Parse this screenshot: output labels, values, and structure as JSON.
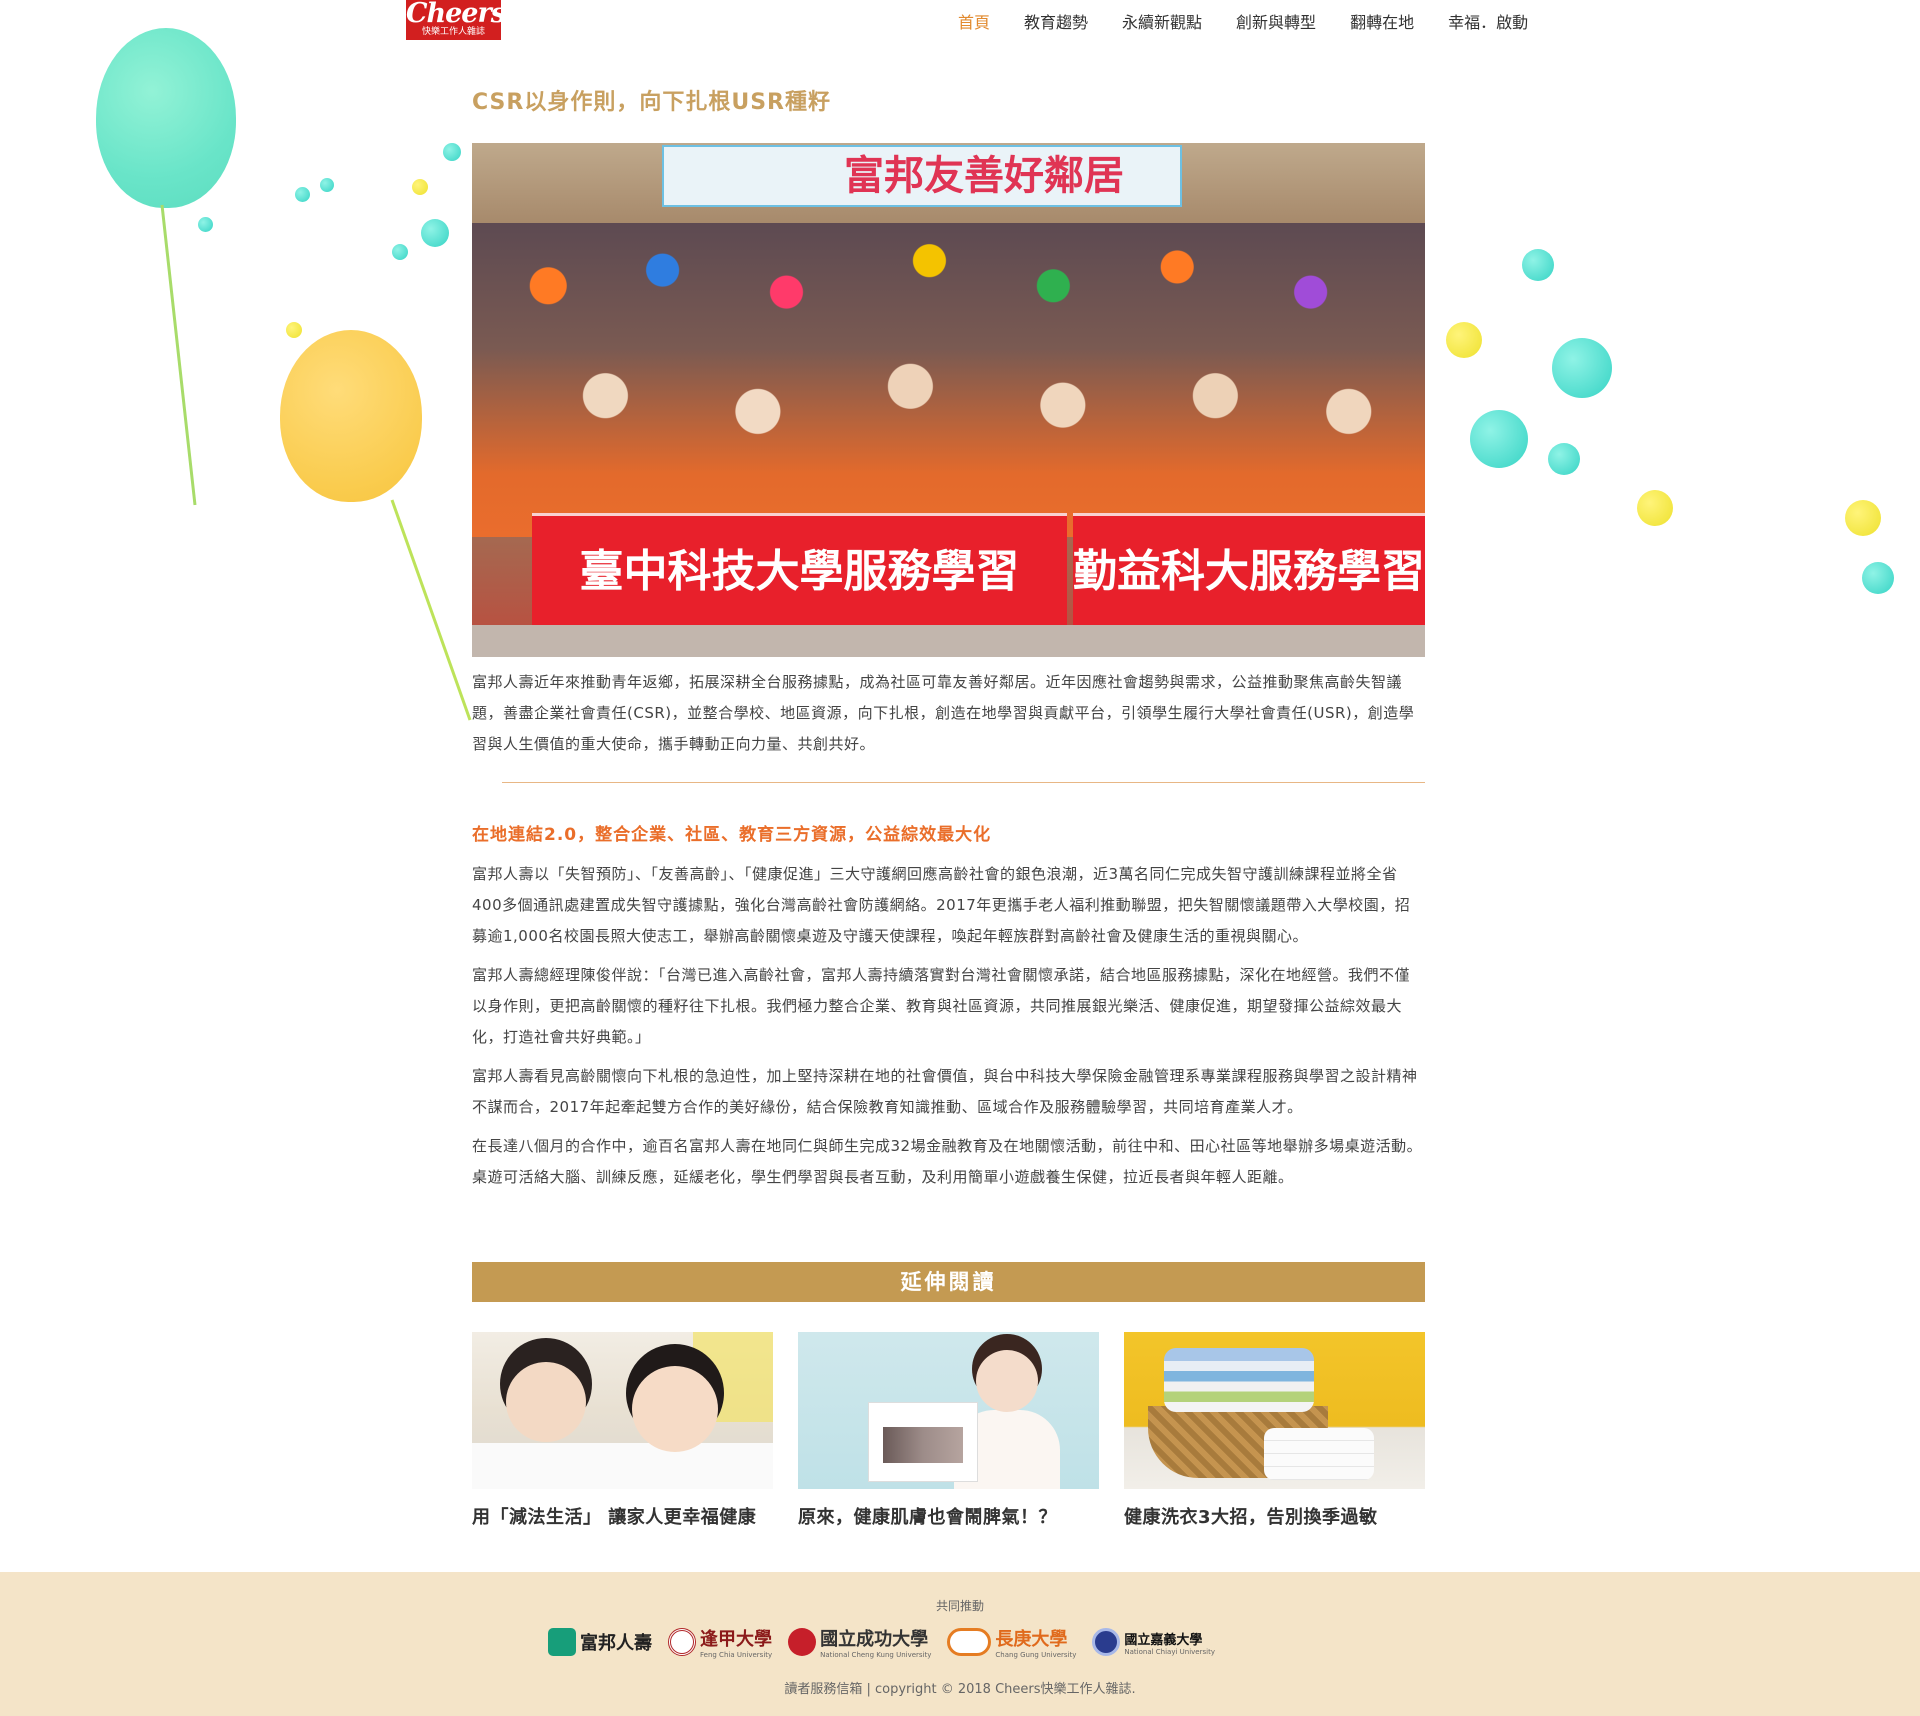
{
  "header": {
    "logo_text": "Cheers",
    "logo_sub": "快樂工作人雜誌",
    "nav": [
      {
        "label": "首頁",
        "active": true
      },
      {
        "label": "教育趨勢"
      },
      {
        "label": "永續新觀點"
      },
      {
        "label": "創新與轉型"
      },
      {
        "label": "翻轉在地"
      },
      {
        "label": "幸福．啟動"
      }
    ]
  },
  "article": {
    "title": "CSR以身作則，向下扎根USR種籽",
    "photo": {
      "banner_top": "富邦友善好鄰居",
      "banner_bottom_left": "臺中科技大學服務學習",
      "banner_bottom_right": "勤益科大服務學習"
    },
    "lead": "富邦人壽近年來推動青年返鄉，拓展深耕全台服務據點，成為社區可靠友善好鄰居。近年因應社會趨勢與需求，公益推動聚焦高齡失智議題，善盡企業社會責任(CSR)，並整合學校、地區資源，向下扎根，創造在地學習與貢獻平台，引領學生履行大學社會責任(USR)，創造學習與人生價值的重大使命，攜手轉動正向力量、共創共好。",
    "subheading": "在地連結2.0，整合企業、社區、教育三方資源，公益綜效最大化",
    "paragraphs": [
      "富邦人壽以「失智預防」、「友善高齡」、「健康促進」三大守護網回應高齡社會的銀色浪潮，近3萬名同仁完成失智守護訓練課程並將全省400多個通訊處建置成失智守護據點，強化台灣高齡社會防護網絡。2017年更攜手老人福利推動聯盟，把失智關懷議題帶入大學校園，招募逾1,000名校園長照大使志工，舉辦高齡關懷桌遊及守護天使課程，喚起年輕族群對高齡社會及健康生活的重視與關心。",
      "富邦人壽總經理陳俊伴說：「台灣已進入高齡社會，富邦人壽持續落實對台灣社會關懷承諾，結合地區服務據點，深化在地經營。我們不僅以身作則，更把高齡關懷的種籽往下扎根。我們極力整合企業、教育與社區資源，共同推展銀光樂活、健康促進，期望發揮公益綜效最大化，打造社會共好典範。」",
      "富邦人壽看見高齡關懷向下札根的急迫性，加上堅持深耕在地的社會價值，與台中科技大學保險金融管理系專業課程服務與學習之設計精神不謀而合，2017年起牽起雙方合作的美好緣份，結合保險教育知識推動、區域合作及服務體驗學習，共同培育產業人才。",
      "在長達八個月的合作中，逾百名富邦人壽在地同仁與師生完成32場金融教育及在地關懷活動，前往中和、田心社區等地舉辦多場桌遊活動。桌遊可活絡大腦、訓練反應，延緩老化，學生們學習與長者互動，及利用簡單小遊戲養生保健，拉近長者與年輕人距離。"
    ]
  },
  "extended": {
    "heading": "延伸閱讀",
    "cards": [
      {
        "caption": "用「減法生活」 讓家人更幸福健康"
      },
      {
        "caption": "原來，健康肌膚也會鬧脾氣！？"
      },
      {
        "caption": "健康洗衣3大招，告別換季過敏"
      }
    ]
  },
  "footer": {
    "co_label": "共同推動",
    "partners": [
      {
        "name": "富邦人壽",
        "en": ""
      },
      {
        "name": "逢甲大學",
        "en": "Feng Chia University"
      },
      {
        "name": "國立成功大學",
        "en": "National Cheng Kung University"
      },
      {
        "name": "長庚大學",
        "en": "Chang Gung University"
      },
      {
        "name": "國立嘉義大學",
        "en": "National Chiayi University"
      }
    ],
    "service_link": "讀者服務信箱",
    "separator": "|",
    "copyright": "copyright © 2018 Cheers快樂工作人雜誌."
  },
  "colors": {
    "accent_gold": "#c8a060",
    "nav_active": "#e28a2e",
    "subheading": "#ea6e2a",
    "ext_bar": "#c49a52",
    "footer_bg": "#f4e4c8",
    "logo_red": "#d21f1f"
  }
}
